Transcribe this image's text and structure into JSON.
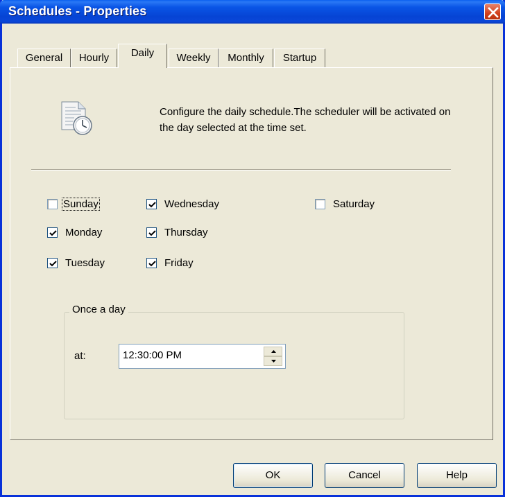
{
  "window": {
    "title": "Schedules - Properties"
  },
  "tabs": [
    {
      "label": "General"
    },
    {
      "label": "Hourly"
    },
    {
      "label": "Daily"
    },
    {
      "label": "Weekly"
    },
    {
      "label": "Monthly"
    },
    {
      "label": "Startup"
    }
  ],
  "active_tab": "Daily",
  "description": "Configure the daily schedule.The scheduler will be activated on the day selected at the time set.",
  "days": {
    "sunday": {
      "label": "Sunday",
      "checked": false
    },
    "monday": {
      "label": "Monday",
      "checked": true
    },
    "tuesday": {
      "label": "Tuesday",
      "checked": true
    },
    "wednesday": {
      "label": "Wednesday",
      "checked": true
    },
    "thursday": {
      "label": "Thursday",
      "checked": true
    },
    "friday": {
      "label": "Friday",
      "checked": true
    },
    "saturday": {
      "label": "Saturday",
      "checked": false
    }
  },
  "once_a_day": {
    "legend": "Once a day",
    "at_label": "at:",
    "time_value": "12:30:00 PM"
  },
  "buttons": {
    "ok": "OK",
    "cancel": "Cancel",
    "help": "Help"
  },
  "icons": {
    "close": "close-icon",
    "schedule": "document-clock-icon"
  }
}
